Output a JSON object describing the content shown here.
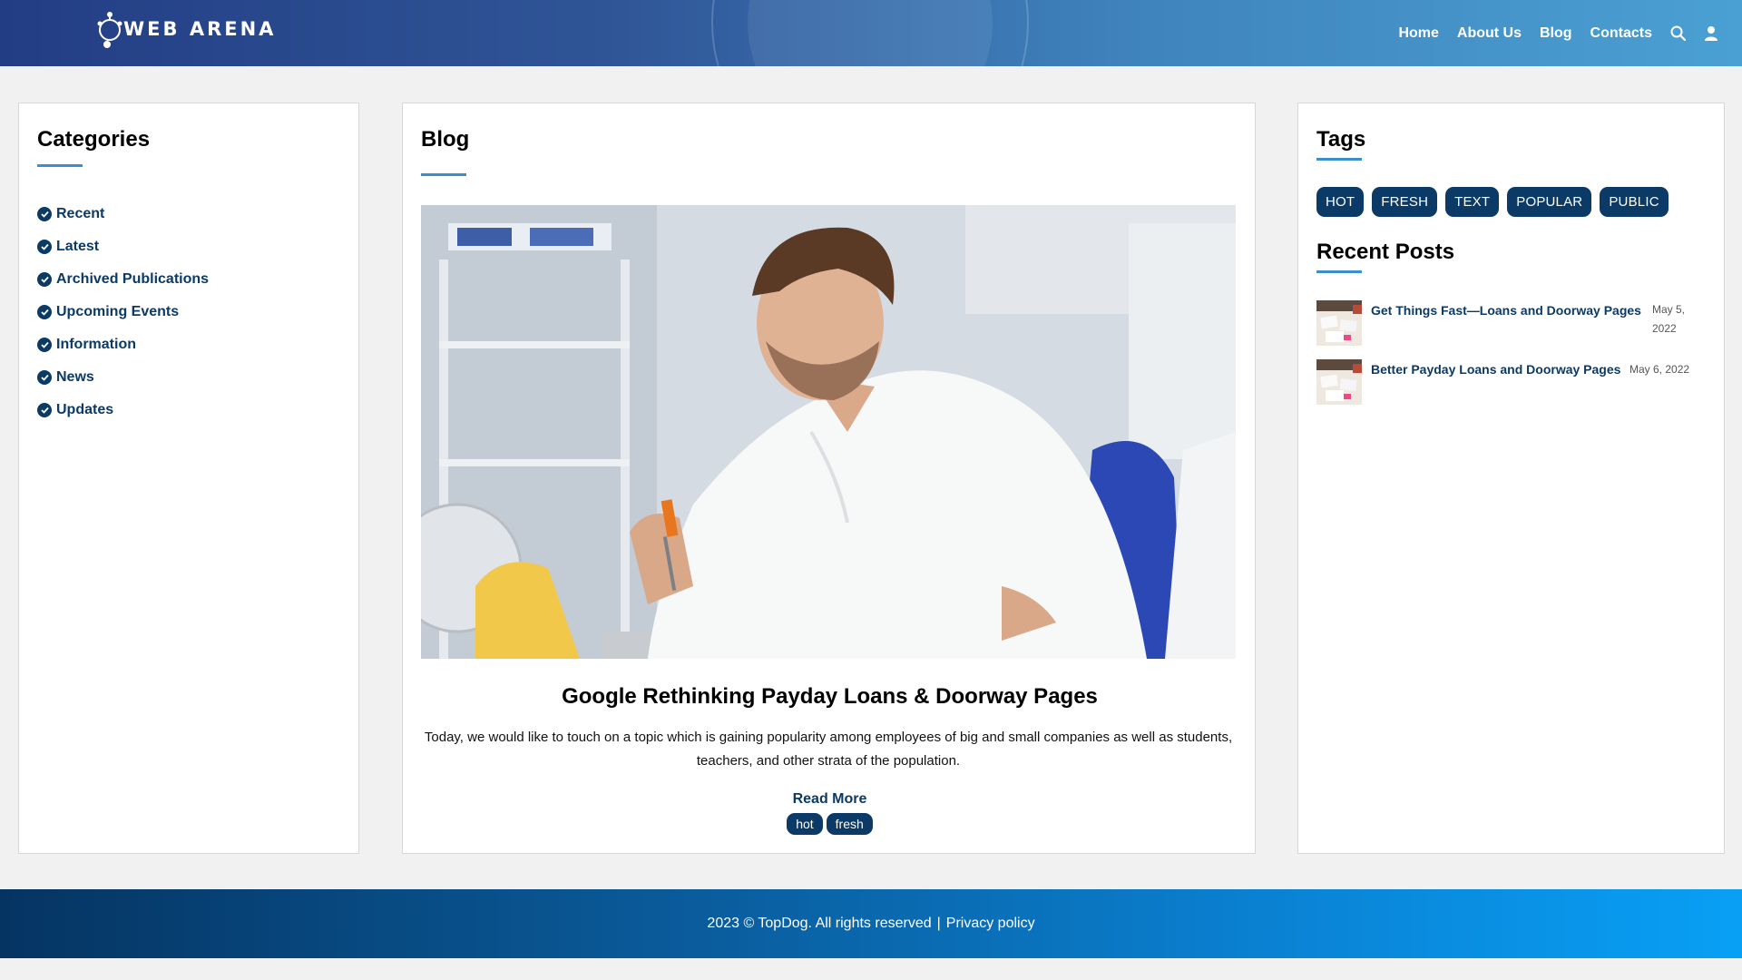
{
  "header": {
    "logo_text": "WEB ARENA",
    "nav": [
      "Home",
      "About Us",
      "Blog",
      "Contacts"
    ],
    "icons": [
      "search-icon",
      "user-icon"
    ]
  },
  "categories": {
    "title": "Categories",
    "items": [
      "Recent",
      "Latest",
      "Archived Publications",
      "Upcoming Events",
      "Information",
      "News",
      "Updates"
    ]
  },
  "blog": {
    "title": "Blog",
    "post": {
      "title": "Google Rethinking Payday Loans & Doorway Pages",
      "excerpt": "Today, we would like to touch on a topic which is gaining popularity among employees of big and small companies as well as students, teachers, and other strata of the population.",
      "read_more": "Read More",
      "tags": [
        "hot",
        "fresh"
      ]
    }
  },
  "tags": {
    "title": "Tags",
    "items": [
      "HOT",
      "FRESH",
      "TEXT",
      "POPULAR",
      "PUBLIC"
    ]
  },
  "recent_posts": {
    "title": "Recent Posts",
    "items": [
      {
        "title": "Get Things Fast—Loans and Doorway Pages",
        "date": "May 5, 2022"
      },
      {
        "title": "Better Payday Loans and Doorway Pages",
        "date": "May 6, 2022"
      }
    ]
  },
  "footer": {
    "copyright": "2023 © TopDog. All rights reserved",
    "separator": "|",
    "privacy": "Privacy policy"
  },
  "colors": {
    "accent_dark": "#0b3a66",
    "underline": "#3a8fd0"
  }
}
